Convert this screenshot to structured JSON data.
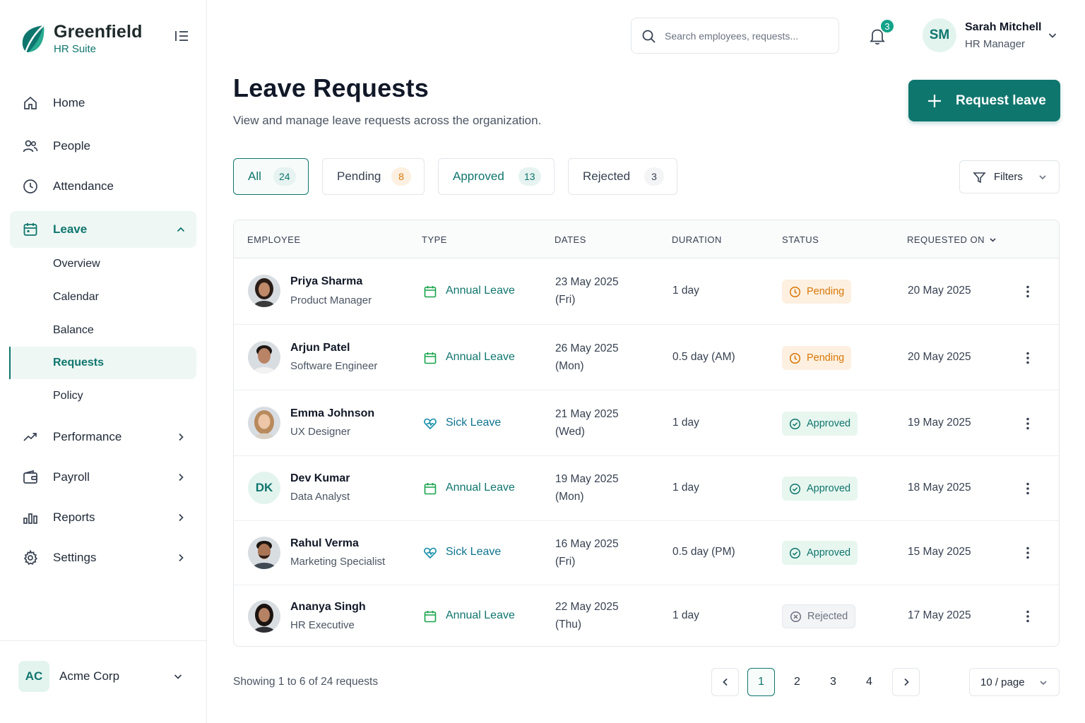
{
  "brand": {
    "name": "Greenfield",
    "subtitle": "HR Suite"
  },
  "colors": {
    "accent": "#0f766e",
    "pending": "#d97706",
    "approved": "#0f766e",
    "rejected": "#6b7280",
    "badge": "#14a38a"
  },
  "sidebar": {
    "items": [
      {
        "label": "Home",
        "icon": "home-icon"
      },
      {
        "label": "People",
        "icon": "people-icon"
      },
      {
        "label": "Attendance",
        "icon": "clock-icon"
      },
      {
        "label": "Leave",
        "icon": "calendar-icon",
        "expanded": true
      },
      {
        "label": "Performance",
        "icon": "trend-icon"
      },
      {
        "label": "Payroll",
        "icon": "wallet-icon"
      },
      {
        "label": "Reports",
        "icon": "bar-chart-icon"
      },
      {
        "label": "Settings",
        "icon": "gear-icon"
      }
    ],
    "leave_sub": [
      "Overview",
      "Calendar",
      "Balance",
      "Requests",
      "Policy"
    ],
    "org": {
      "initials": "AC",
      "name": "Acme Corp"
    }
  },
  "header": {
    "search_placeholder": "Search employees, requests...",
    "notifications": "3",
    "user": {
      "initials": "SM",
      "name": "Sarah Mitchell",
      "role": "HR Manager"
    }
  },
  "page": {
    "title": "Leave Requests",
    "subtitle": "View and manage leave requests across the organization.",
    "primary_action": "Request leave"
  },
  "tabs": [
    {
      "label": "All",
      "count": "24"
    },
    {
      "label": "Pending",
      "count": "8"
    },
    {
      "label": "Approved",
      "count": "13"
    },
    {
      "label": "Rejected",
      "count": "3"
    }
  ],
  "filters_label": "Filters",
  "table": {
    "columns": [
      "EMPLOYEE",
      "TYPE",
      "DATES",
      "DURATION",
      "STATUS",
      "REQUESTED ON"
    ],
    "rows": [
      {
        "name": "Priya Sharma",
        "role": "Product Manager",
        "type": "Annual Leave",
        "date": "23 May 2025",
        "day": "(Fri)",
        "duration": "1 day",
        "status": "Pending",
        "requested": "20 May 2025"
      },
      {
        "name": "Arjun Patel",
        "role": "Software Engineer",
        "type": "Annual Leave",
        "date": "26 May 2025",
        "day": "(Mon)",
        "duration": "0.5 day (AM)",
        "status": "Pending",
        "requested": "20 May 2025"
      },
      {
        "name": "Emma Johnson",
        "role": "UX Designer",
        "type": "Sick Leave",
        "date": "21 May 2025",
        "day": "(Wed)",
        "duration": "1 day",
        "status": "Approved",
        "requested": "19 May 2025"
      },
      {
        "name": "Dev Kumar",
        "initials": "DK",
        "role": "Data Analyst",
        "type": "Annual Leave",
        "date": "19 May 2025",
        "day": "(Mon)",
        "duration": "1 day",
        "status": "Approved",
        "requested": "18 May 2025"
      },
      {
        "name": "Rahul Verma",
        "role": "Marketing Specialist",
        "type": "Sick Leave",
        "date": "16 May 2025",
        "day": "(Fri)",
        "duration": "0.5 day (PM)",
        "status": "Approved",
        "requested": "15 May 2025"
      },
      {
        "name": "Ananya Singh",
        "role": "HR Executive",
        "type": "Annual Leave",
        "date": "22 May 2025",
        "day": "(Thu)",
        "duration": "1 day",
        "status": "Rejected",
        "requested": "17 May 2025"
      }
    ]
  },
  "pagination": {
    "showing": "Showing 1 to 6 of 24 requests",
    "pages": [
      "1",
      "2",
      "3",
      "4"
    ],
    "current": "1",
    "per_page": "10 / page"
  }
}
